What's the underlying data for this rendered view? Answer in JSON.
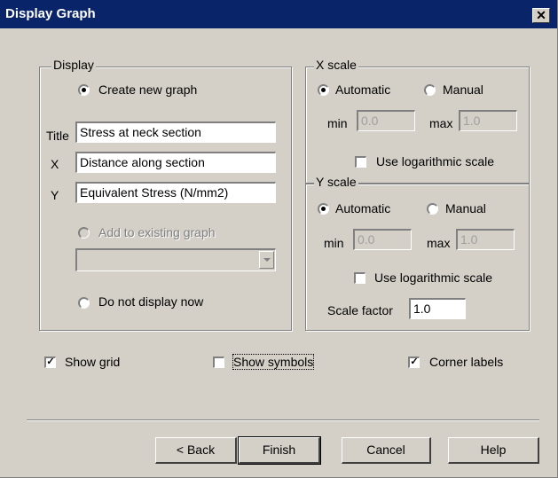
{
  "window": {
    "title": "Display Graph",
    "close_glyph": "✕"
  },
  "display_group": {
    "label": "Display",
    "create_new_graph": "Create new graph",
    "title_label": "Title",
    "title_value": "Stress at neck section",
    "x_label": "X",
    "x_value": "Distance along section",
    "y_label": "Y",
    "y_value": "Equivalent Stress (N/mm2)",
    "add_to_existing": "Add to existing graph",
    "existing_graph_value": "",
    "do_not_display": "Do not display now",
    "selected": "create_new_graph"
  },
  "x_scale": {
    "label": "X scale",
    "automatic": "Automatic",
    "manual": "Manual",
    "selected": "automatic",
    "min_label": "min",
    "min_value": "0.0",
    "max_label": "max",
    "max_value": "1.0",
    "log_label": "Use logarithmic scale",
    "log_checked": false
  },
  "y_scale": {
    "label": "Y scale",
    "automatic": "Automatic",
    "manual": "Manual",
    "selected": "automatic",
    "min_label": "min",
    "min_value": "0.0",
    "max_label": "max",
    "max_value": "1.0",
    "log_label": "Use logarithmic scale",
    "log_checked": false,
    "scale_factor_label": "Scale factor",
    "scale_factor_value": "1.0"
  },
  "options": {
    "show_grid": "Show grid",
    "show_grid_checked": true,
    "show_symbols": "Show symbols",
    "show_symbols_checked": false,
    "corner_labels": "Corner labels",
    "corner_labels_checked": true
  },
  "buttons": {
    "back": "< Back",
    "finish": "Finish",
    "cancel": "Cancel",
    "help": "Help"
  }
}
